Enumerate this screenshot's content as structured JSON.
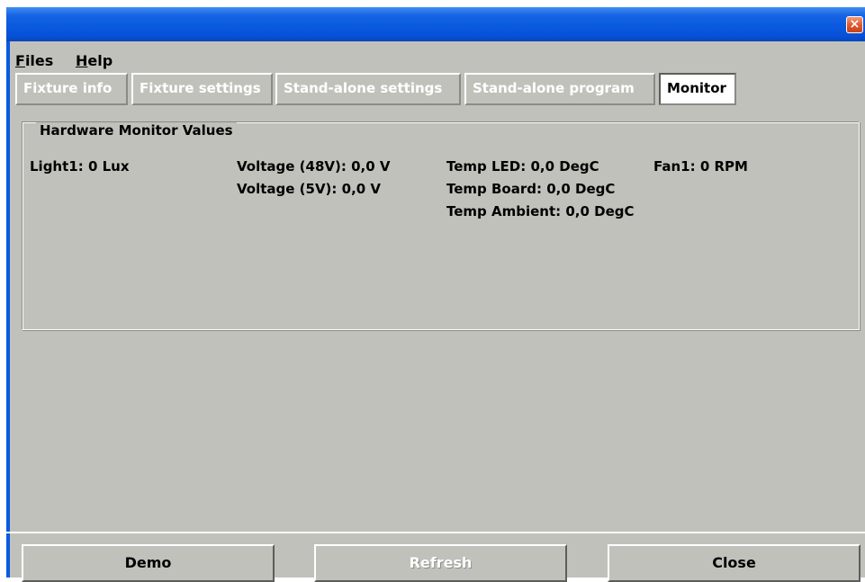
{
  "titlebar": {
    "close_glyph": "×",
    "close_icon": "close-icon"
  },
  "menu": {
    "files": {
      "accel": "F",
      "rest": "iles"
    },
    "help": {
      "accel": "H",
      "rest": "elp"
    }
  },
  "tabs": [
    {
      "label": "Fixture info",
      "active": false
    },
    {
      "label": "Fixture settings",
      "active": false
    },
    {
      "label": "Stand-alone settings",
      "active": false
    },
    {
      "label": "Stand-alone program",
      "active": false
    },
    {
      "label": "Monitor",
      "active": true
    }
  ],
  "monitor": {
    "group_title": "Hardware Monitor Values",
    "light1": "Light1: 0 Lux",
    "voltage48": "Voltage (48V): 0,0 V",
    "voltage5": "Voltage (5V): 0,0 V",
    "temp_led": "Temp LED: 0,0 DegC",
    "temp_board": "Temp Board: 0,0 DegC",
    "temp_ambient": "Temp Ambient: 0,0 DegC",
    "fan1": "Fan1: 0 RPM"
  },
  "buttons": {
    "demo": "Demo",
    "refresh": "Refresh",
    "close": "Close"
  },
  "colors": {
    "window_bg": "#c1c1bc",
    "titlebar_blue": "#0a5ae0",
    "close_red": "#e25b2e"
  }
}
